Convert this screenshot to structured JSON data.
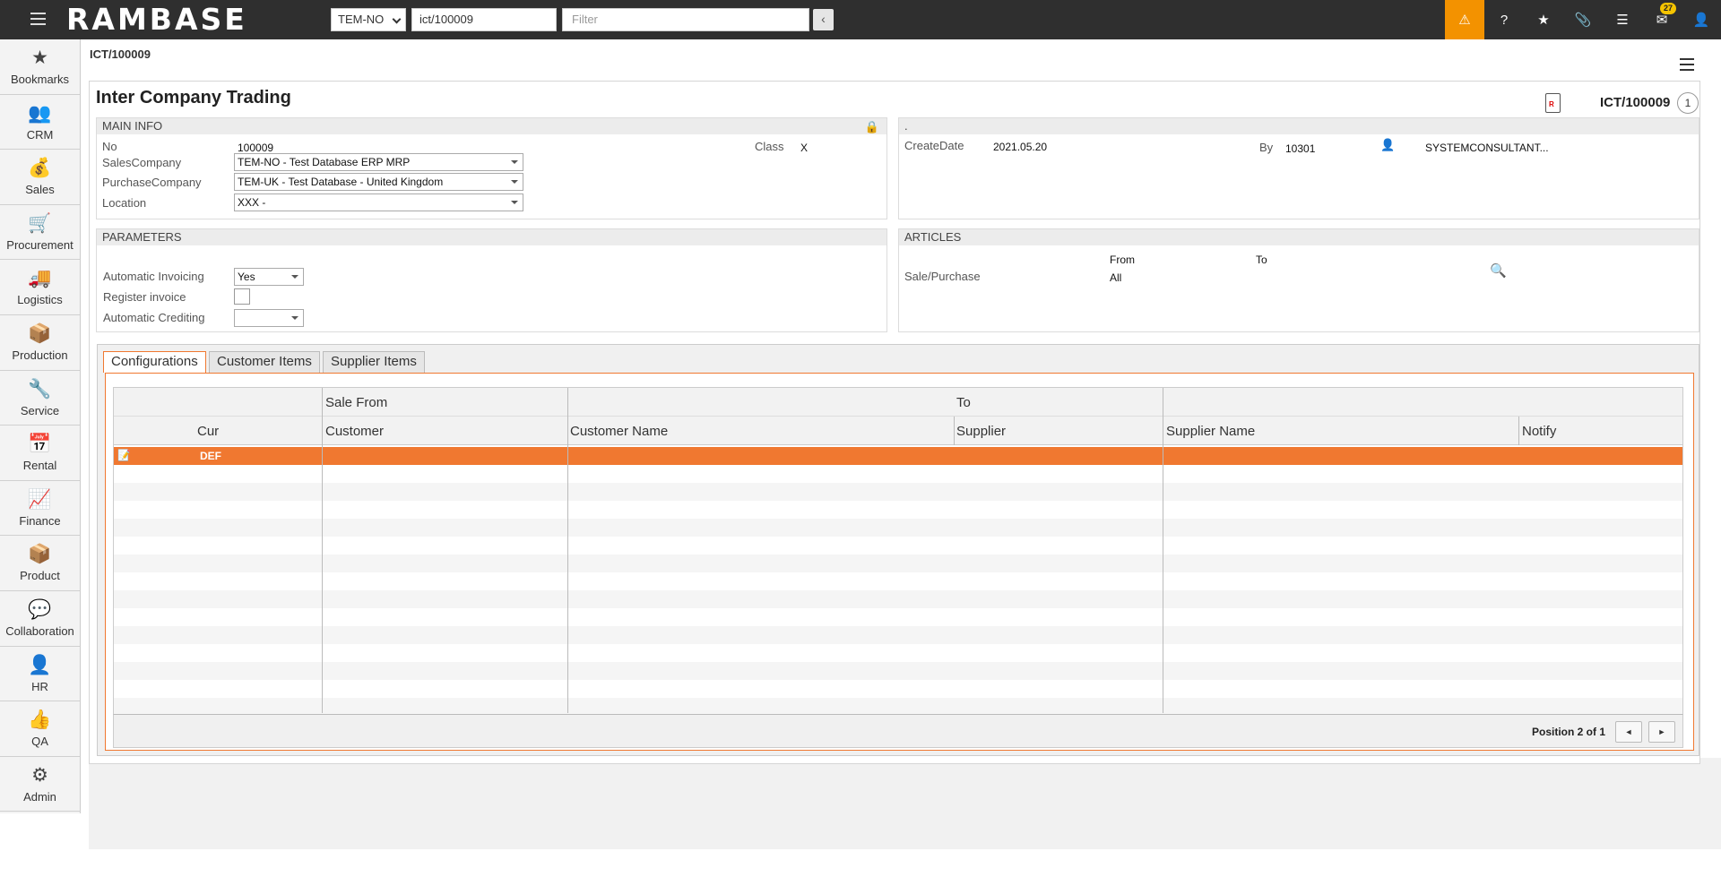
{
  "topbar": {
    "logo": "RAMBASE",
    "company": "TEM-NO",
    "search_value": "ict/100009",
    "filter_placeholder": "Filter",
    "collapse": "‹",
    "mail_count": "27"
  },
  "sidebar": {
    "items": [
      {
        "label": "Bookmarks",
        "icon": "★"
      },
      {
        "label": "CRM",
        "icon": "👥"
      },
      {
        "label": "Sales",
        "icon": "💰"
      },
      {
        "label": "Procurement",
        "icon": "🛒"
      },
      {
        "label": "Logistics",
        "icon": "🚚"
      },
      {
        "label": "Production",
        "icon": "📦"
      },
      {
        "label": "Service",
        "icon": "🔧"
      },
      {
        "label": "Rental",
        "icon": "📅"
      },
      {
        "label": "Finance",
        "icon": "📈"
      },
      {
        "label": "Product",
        "icon": "📦"
      },
      {
        "label": "Collaboration",
        "icon": "💬"
      },
      {
        "label": "HR",
        "icon": "👤"
      },
      {
        "label": "QA",
        "icon": "👍"
      },
      {
        "label": "Admin",
        "icon": "⚙"
      }
    ]
  },
  "breadcrumb": "ICT/100009",
  "page": {
    "title": "Inter Company Trading",
    "doc_id": "ICT/100009",
    "doc_count": "1"
  },
  "main_info": {
    "header": "MAIN INFO",
    "no_label": "No",
    "no_value": "100009",
    "class_label": "Class",
    "class_value": "X",
    "sales_company_label": "SalesCompany",
    "sales_company_value": "TEM-NO - Test Database ERP MRP",
    "purchase_company_label": "PurchaseCompany",
    "purchase_company_value": "TEM-UK - Test Database - United Kingdom",
    "location_label": "Location",
    "location_value": "XXX -"
  },
  "right_info": {
    "header": ".",
    "create_date_label": "CreateDate",
    "create_date_value": "2021.05.20",
    "by_label": "By",
    "by_value": "10301",
    "user_name": "SYSTEMCONSULTANT..."
  },
  "parameters": {
    "header": "PARAMETERS",
    "auto_invoicing_label": "Automatic Invoicing",
    "auto_invoicing_value": "Yes",
    "register_invoice_label": "Register invoice",
    "auto_crediting_label": "Automatic Crediting",
    "auto_crediting_value": ""
  },
  "articles": {
    "header": "ARTICLES",
    "from_label": "From",
    "to_label": "To",
    "sale_purchase_label": "Sale/Purchase",
    "sale_purchase_value": "All"
  },
  "tabs": [
    {
      "label": "Configurations"
    },
    {
      "label": "Customer Items"
    },
    {
      "label": "Supplier Items"
    }
  ],
  "grid": {
    "group_sale_from": "Sale From",
    "group_to": "To",
    "columns": [
      "Cur",
      "Customer",
      "Customer Name",
      "Supplier",
      "Supplier Name",
      "Notify"
    ],
    "rows": [
      {
        "cur": "DEF",
        "customer": "",
        "customer_name": "",
        "supplier": "",
        "supplier_name": "",
        "notify": ""
      }
    ],
    "position_text": "Position 2 of 1",
    "prev": "◄",
    "next": "►"
  }
}
